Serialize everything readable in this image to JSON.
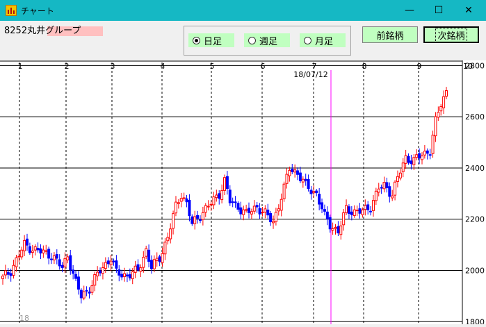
{
  "window": {
    "title": "チャート",
    "minimize": "—",
    "maximize": "☐",
    "close": "✕"
  },
  "stock": {
    "name": "8252丸井グループ"
  },
  "period": {
    "options": [
      {
        "label": "日足",
        "selected": true
      },
      {
        "label": "週足",
        "selected": false
      },
      {
        "label": "月足",
        "selected": false
      }
    ]
  },
  "buttons": {
    "prev": "前銘柄",
    "next": "次銘柄"
  },
  "chart_data": {
    "type": "candlestick",
    "y_ticks": [
      2800,
      2600,
      2400,
      2200,
      2000,
      1800
    ],
    "ylim": [
      1790,
      2820
    ],
    "month_labels": [
      "1",
      "2",
      "3",
      "4",
      "5",
      "6",
      "7",
      "8",
      "9",
      "10"
    ],
    "year_label": "18",
    "cursor_date": "18/07/12",
    "up_color": "#ff0000",
    "down_color": "#0000ff",
    "cursor_color": "#ff00ff",
    "anchors": [
      [
        0,
        1970
      ],
      [
        3,
        2000
      ],
      [
        8,
        2100
      ],
      [
        12,
        2080
      ],
      [
        18,
        2060
      ],
      [
        22,
        2010
      ],
      [
        24,
        2060
      ],
      [
        27,
        1950
      ],
      [
        29,
        1900
      ],
      [
        32,
        1930
      ],
      [
        36,
        2000
      ],
      [
        40,
        2050
      ],
      [
        42,
        1990
      ],
      [
        46,
        1980
      ],
      [
        50,
        2000
      ],
      [
        53,
        2080
      ],
      [
        55,
        2010
      ],
      [
        58,
        2050
      ],
      [
        61,
        2130
      ],
      [
        64,
        2250
      ],
      [
        66,
        2300
      ],
      [
        68,
        2260
      ],
      [
        70,
        2180
      ],
      [
        74,
        2230
      ],
      [
        76,
        2250
      ],
      [
        80,
        2300
      ],
      [
        82,
        2350
      ],
      [
        84,
        2270
      ],
      [
        87,
        2250
      ],
      [
        90,
        2220
      ],
      [
        94,
        2250
      ],
      [
        97,
        2220
      ],
      [
        100,
        2190
      ],
      [
        104,
        2320
      ],
      [
        106,
        2400
      ],
      [
        109,
        2380
      ],
      [
        112,
        2330
      ],
      [
        116,
        2300
      ],
      [
        119,
        2210
      ],
      [
        121,
        2180
      ],
      [
        124,
        2150
      ],
      [
        127,
        2240
      ],
      [
        130,
        2230
      ],
      [
        133,
        2230
      ],
      [
        136,
        2250
      ],
      [
        139,
        2320
      ],
      [
        141,
        2330
      ],
      [
        144,
        2300
      ],
      [
        146,
        2360
      ],
      [
        149,
        2440
      ],
      [
        152,
        2430
      ],
      [
        155,
        2450
      ],
      [
        158,
        2470
      ],
      [
        160,
        2580
      ],
      [
        162,
        2650
      ],
      [
        164,
        2700
      ]
    ]
  }
}
